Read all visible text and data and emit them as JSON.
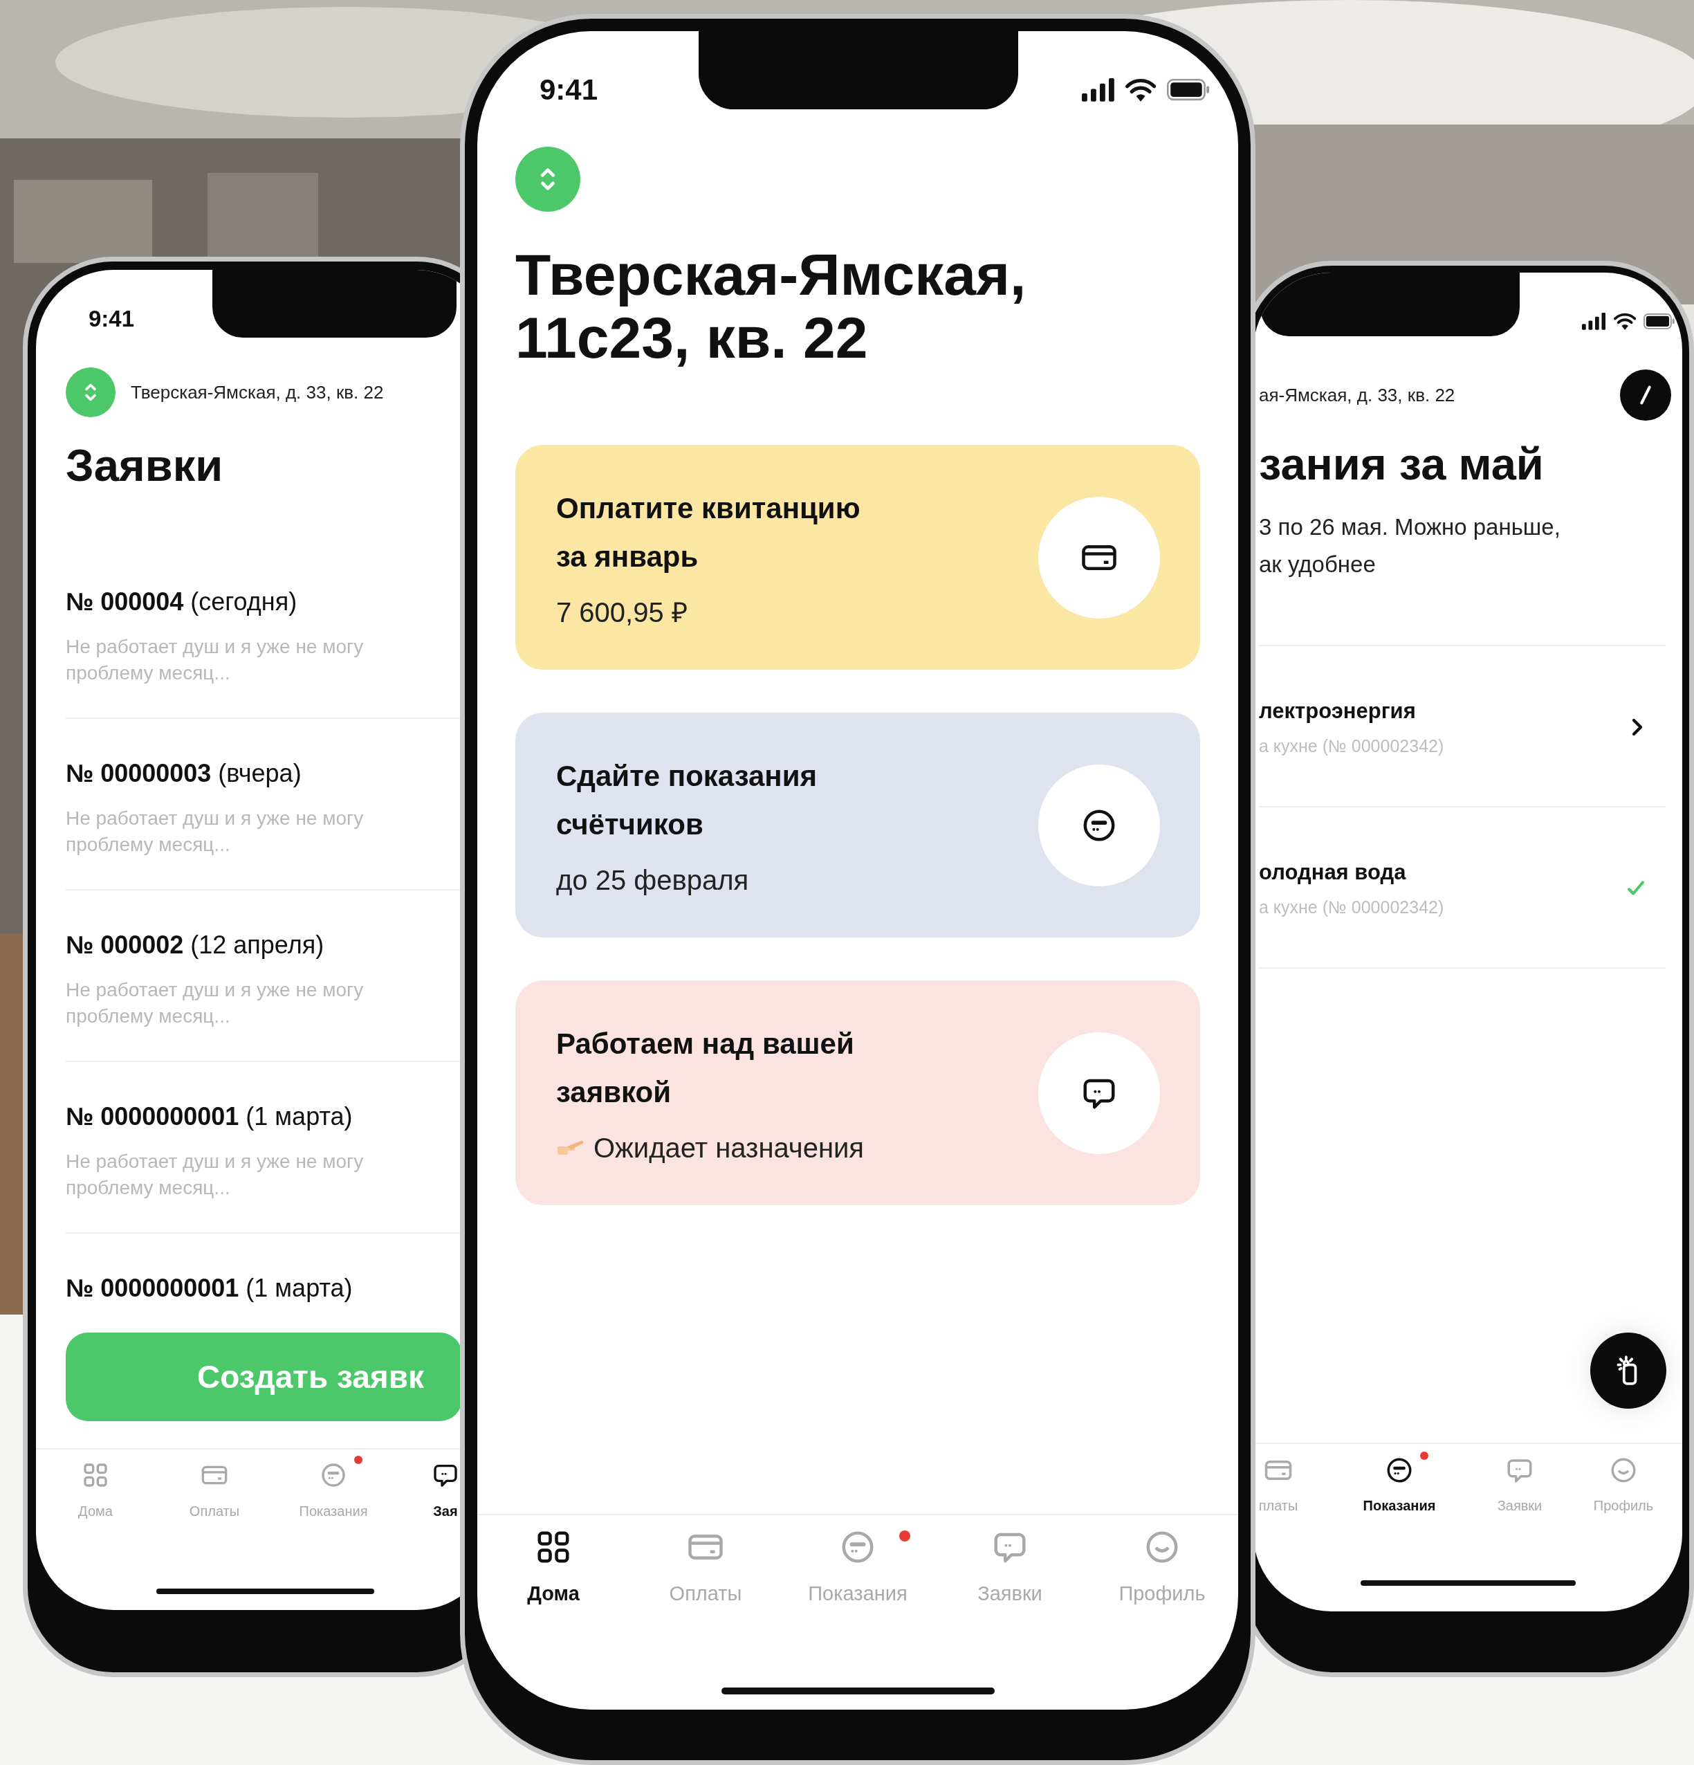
{
  "phones": [
    {
      "kind": "requests",
      "time": "9:41",
      "address": "Тверская-Ямская, д. 33, кв. 22",
      "title": "Заявки",
      "requests": [
        {
          "heading": "**№ 000004** (сегодня)",
          "description": [
            "Не работает душ и я уже не могу",
            "проблему месяц..."
          ]
        },
        {
          "heading": "**№ 00000003** (вчера)",
          "description": [
            "Не работает душ и я уже не могу",
            "проблему месяц..."
          ]
        },
        {
          "heading": "**№ 000002** (12 апреля)",
          "description": [
            "Не работает душ и я уже не могу",
            "проблему месяц..."
          ]
        },
        {
          "heading": "**№ 0000000001** (1 марта)",
          "description": [
            "Не работает душ и я уже не могу",
            "проблему месяц..."
          ]
        },
        {
          "heading": "**№ 0000000001** (1 марта)"
        }
      ],
      "create_button": "Создать заявк",
      "nav": [
        {
          "kind": "home",
          "label": "Дома",
          "selected": false,
          "badge": false
        },
        {
          "kind": "payments",
          "label": "Оплаты",
          "selected": false,
          "badge": false
        },
        {
          "kind": "meters",
          "label": "Показания",
          "selected": false,
          "badge": true
        },
        {
          "kind": "requests",
          "label": "Зая",
          "selected": true,
          "badge": false
        }
      ]
    },
    {
      "kind": "home",
      "time": "9:41",
      "title": "Тверская-Ямская, 11с23, кв. 22",
      "cards": [
        {
          "kind": "payment",
          "color": "#fbe6a4",
          "title": [
            "Оплатите квитанцию",
            "за январь"
          ],
          "subtitle": "7 600,95 ₽"
        },
        {
          "kind": "meters",
          "color": "#dfe3f0",
          "title": [
            "Сдайте показания",
            "счётчиков"
          ],
          "subtitle": "до 25 февраля"
        },
        {
          "kind": "request",
          "color": "#fbe3e1",
          "title": [
            "Работаем над вашей",
            "заявкой"
          ],
          "subtitle": "Ожидает назначения"
        }
      ],
      "nav": [
        {
          "kind": "home",
          "label": "Дома",
          "selected": true,
          "badge": false
        },
        {
          "kind": "payments",
          "label": "Оплаты",
          "selected": false,
          "badge": false
        },
        {
          "kind": "meters",
          "label": "Показания",
          "selected": false,
          "badge": true
        },
        {
          "kind": "requests",
          "label": "Заявки",
          "selected": false,
          "badge": false
        },
        {
          "kind": "profile",
          "label": "Профиль",
          "selected": false,
          "badge": false
        }
      ]
    },
    {
      "kind": "meters",
      "address": "ая-Ямская, д. 33, кв. 22",
      "title": "зания за май",
      "description": [
        "3 по 26 мая. Можно раньше,",
        "ак удобнее"
      ],
      "meters": [
        {
          "title": "лектроэнергия",
          "subtitle": "а кухне (№ 000002342)",
          "submitted": false
        },
        {
          "title": "олодная вода",
          "subtitle": "а кухне (№ 000002342)",
          "submitted": true
        }
      ],
      "nav": [
        {
          "kind": "payments",
          "label": "платы",
          "selected": false,
          "badge": false
        },
        {
          "kind": "meters",
          "label": "Показания",
          "selected": true,
          "badge": true
        },
        {
          "kind": "requests",
          "label": "Заявки",
          "selected": false,
          "badge": false
        },
        {
          "kind": "profile",
          "label": "Профиль",
          "selected": false,
          "badge": false
        }
      ]
    }
  ]
}
